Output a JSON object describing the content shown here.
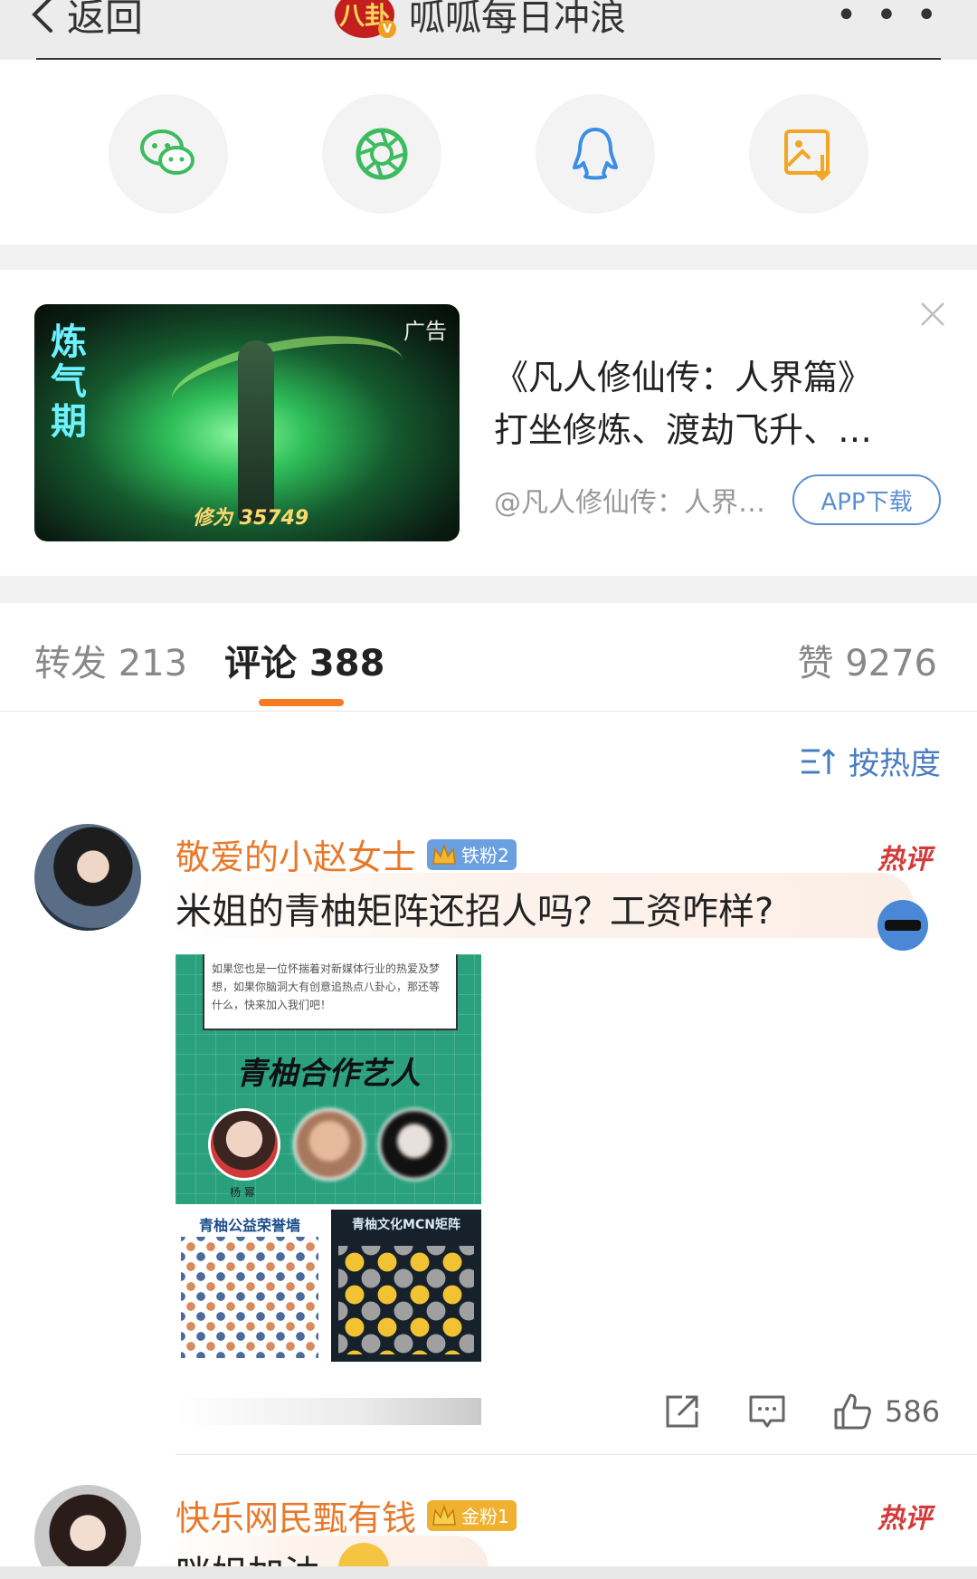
{
  "nav": {
    "back_label": "返回",
    "account_name": "呱呱每日冲浪",
    "logo_text": "八卦",
    "verified_mark": "V",
    "more_label": "• • •"
  },
  "share": {
    "items": [
      {
        "name": "wechat-icon",
        "color": "#3dbb5f"
      },
      {
        "name": "moments-icon",
        "color": "#3dbb5f"
      },
      {
        "name": "qq-icon",
        "color": "#3a8ee6"
      },
      {
        "name": "save-image-icon",
        "color": "#f2a623"
      }
    ]
  },
  "ad": {
    "tag": "广告",
    "thumb_text": "炼气期",
    "thumb_score": "修为 35749",
    "line1": "《凡人修仙传：人界篇》",
    "line2": "打坐修炼、渡劫飞升、…",
    "source": "@凡人修仙传：人界…",
    "download_label": "APP下载"
  },
  "tabs": {
    "repost": "转发 213",
    "comment": "评论 388",
    "like": "赞 9276"
  },
  "sort": {
    "label": "按热度"
  },
  "comments": [
    {
      "username": "敬爱的小赵女士",
      "badge": "铁粉2",
      "hot_label": "热评",
      "text": "米姐的青柚矩阵还招人吗？工资咋样?",
      "image": {
        "intro": "如果您也是一位怀揣着对新媒体行业的热爱及梦想，如果你脑洞大有创意追热点八卦心，那还等什么，快来加入我们吧！",
        "headline": "青柚合作艺人",
        "artist_name": "杨 幂",
        "panel_left_title": "青柚公益荣誉墙",
        "panel_right_title": "青柚文化MCN矩阵"
      },
      "like_count": "586"
    },
    {
      "username": "快乐网民甄有钱",
      "badge": "金粉1",
      "hot_label": "热评",
      "text": "咪姐加油"
    }
  ],
  "colors": {
    "accent": "#f47b22",
    "username": "#e8792b",
    "link_blue": "#4a7cc0",
    "hot_red": "#d43a3a"
  }
}
